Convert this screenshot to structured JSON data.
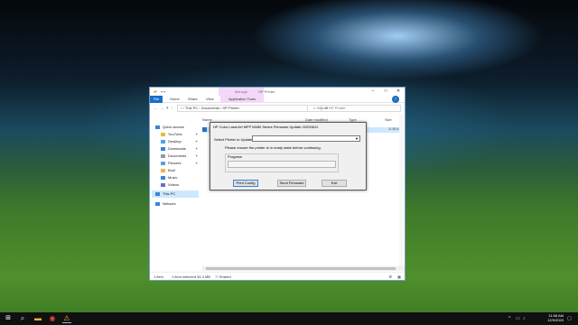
{
  "explorer": {
    "manage_tab": "Manage",
    "window_title": "HP Printer",
    "ribbon_tabs": [
      "File",
      "Home",
      "Share",
      "View",
      "Application Tools"
    ],
    "address_path": [
      "This PC",
      "Documents",
      "HP Printer"
    ],
    "search_placeholder": "Search HP Printer",
    "columns": {
      "name": "Name",
      "date": "Date modified",
      "type": "Type",
      "size": "Size"
    },
    "file_row_time": "11:58 AM",
    "nav": [
      {
        "label": "Quick access",
        "icon": "star-icon",
        "pinned": false
      },
      {
        "label": "YouTube",
        "icon": "folder-icon",
        "pinned": true
      },
      {
        "label": "Desktop",
        "icon": "folder-icon",
        "pinned": true
      },
      {
        "label": "Downloads",
        "icon": "download-icon",
        "pinned": true
      },
      {
        "label": "Documents",
        "icon": "documents-icon",
        "pinned": true
      },
      {
        "label": "Pictures",
        "icon": "pictures-icon",
        "pinned": true
      },
      {
        "label": "Broll",
        "icon": "folder-icon",
        "pinned": false
      },
      {
        "label": "Music",
        "icon": "music-icon",
        "pinned": false
      },
      {
        "label": "Videos",
        "icon": "videos-icon",
        "pinned": false
      },
      {
        "label": "This PC",
        "icon": "pc-icon",
        "pinned": false
      },
      {
        "label": "Network",
        "icon": "network-icon",
        "pinned": false
      }
    ],
    "status": {
      "items": "1 item",
      "selected": "1 item selected  34.3 MB",
      "shared": "Shared"
    }
  },
  "dialog": {
    "title": "HP Color LaserJet MFP M480 Series  Firmware Update 20200612",
    "select_label": "Select Printer to Update:",
    "select_value": "",
    "note": "Please ensure the printer is in ready state before continuing.",
    "progress_label": "Progress",
    "progress_value": 0,
    "buttons": {
      "print_config": "Print Config",
      "send_firmware": "Send Firmware",
      "exit": "Exit"
    }
  },
  "taskbar": {
    "time": "11:58 AM",
    "date": "12/9/2020"
  },
  "colors": {
    "accent": "#1a6fc7",
    "manage": "#f3d8f7",
    "selection": "#cce8ff"
  }
}
